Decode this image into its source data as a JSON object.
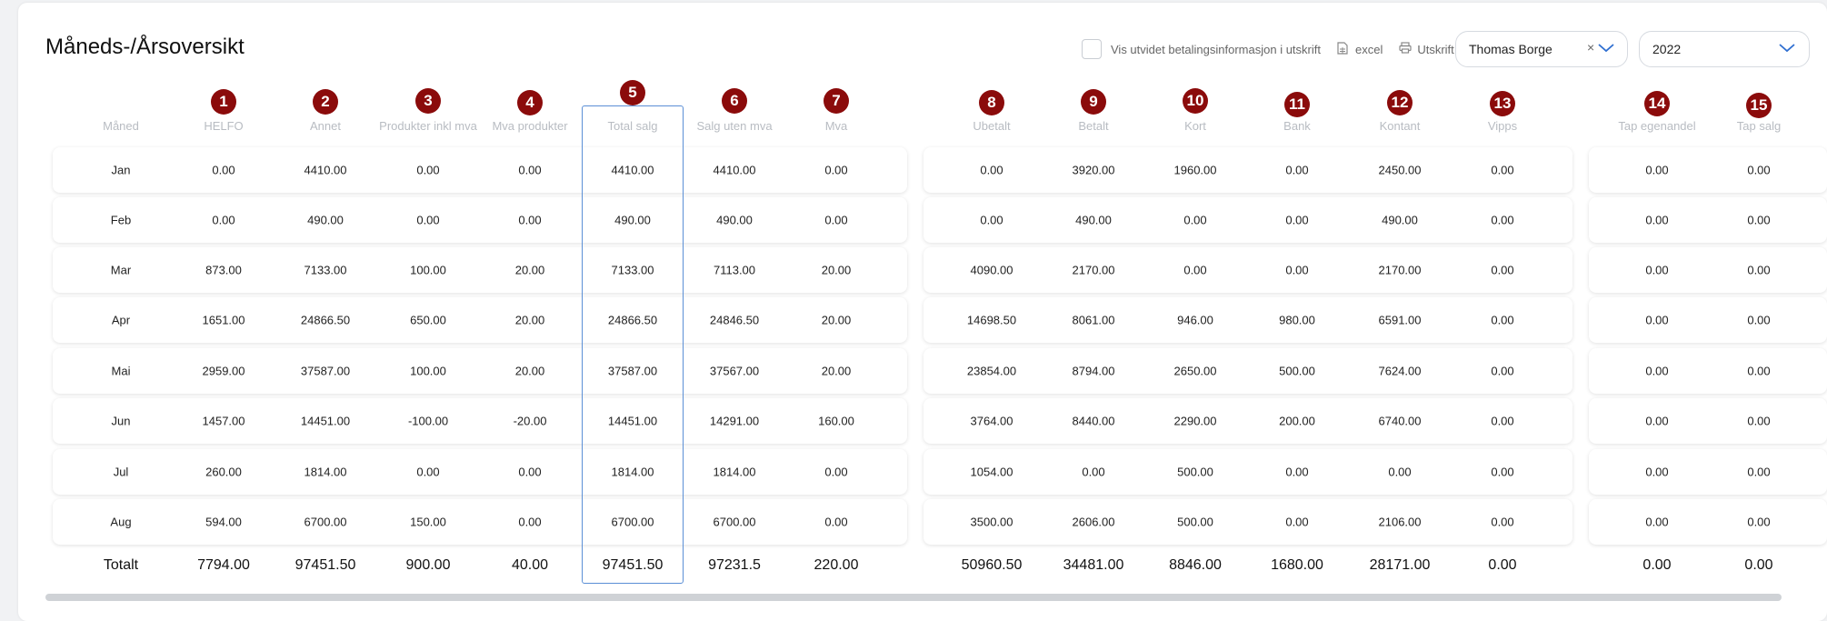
{
  "page": {
    "title": "Måneds-/Årsoversikt",
    "checkbox_label": "Vis utvidet betalingsinformasjon i utskrift",
    "excel_label": "excel",
    "print_label": "Utskrift",
    "person_select": "Thomas Borge",
    "year_select": "2022"
  },
  "icons": {
    "excel": "file-spreadsheet-icon",
    "print": "printer-icon",
    "clear": "close-icon",
    "dropdown": "chevron-down-icon"
  },
  "colors": {
    "badge": "#8b0b0b",
    "highlight_border": "#5b8fd6",
    "header_text": "#b8bcc2"
  },
  "table": {
    "month_header": "Måned",
    "total_label": "Totalt",
    "columns": [
      {
        "num": "1",
        "label": "HELFO"
      },
      {
        "num": "2",
        "label": "Annet"
      },
      {
        "num": "3",
        "label": "Produkter inkl mva"
      },
      {
        "num": "4",
        "label": "Mva produkter"
      },
      {
        "num": "5",
        "label": "Total salg"
      },
      {
        "num": "6",
        "label": "Salg uten mva"
      },
      {
        "num": "7",
        "label": "Mva"
      },
      {
        "num": "8",
        "label": "Ubetalt"
      },
      {
        "num": "9",
        "label": "Betalt"
      },
      {
        "num": "10",
        "label": "Kort"
      },
      {
        "num": "11",
        "label": "Bank"
      },
      {
        "num": "12",
        "label": "Kontant"
      },
      {
        "num": "13",
        "label": "Vipps"
      },
      {
        "num": "14",
        "label": "Tap egenandel"
      },
      {
        "num": "15",
        "label": "Tap salg"
      }
    ],
    "rows": [
      {
        "month": "Jan",
        "values": [
          "0.00",
          "4410.00",
          "0.00",
          "0.00",
          "4410.00",
          "4410.00",
          "0.00",
          "0.00",
          "3920.00",
          "1960.00",
          "0.00",
          "2450.00",
          "0.00",
          "0.00",
          "0.00"
        ]
      },
      {
        "month": "Feb",
        "values": [
          "0.00",
          "490.00",
          "0.00",
          "0.00",
          "490.00",
          "490.00",
          "0.00",
          "0.00",
          "490.00",
          "0.00",
          "0.00",
          "490.00",
          "0.00",
          "0.00",
          "0.00"
        ]
      },
      {
        "month": "Mar",
        "values": [
          "873.00",
          "7133.00",
          "100.00",
          "20.00",
          "7133.00",
          "7113.00",
          "20.00",
          "4090.00",
          "2170.00",
          "0.00",
          "0.00",
          "2170.00",
          "0.00",
          "0.00",
          "0.00"
        ]
      },
      {
        "month": "Apr",
        "values": [
          "1651.00",
          "24866.50",
          "650.00",
          "20.00",
          "24866.50",
          "24846.50",
          "20.00",
          "14698.50",
          "8061.00",
          "946.00",
          "980.00",
          "6591.00",
          "0.00",
          "0.00",
          "0.00"
        ]
      },
      {
        "month": "Mai",
        "values": [
          "2959.00",
          "37587.00",
          "100.00",
          "20.00",
          "37587.00",
          "37567.00",
          "20.00",
          "23854.00",
          "8794.00",
          "2650.00",
          "500.00",
          "7624.00",
          "0.00",
          "0.00",
          "0.00"
        ]
      },
      {
        "month": "Jun",
        "values": [
          "1457.00",
          "14451.00",
          "-100.00",
          "-20.00",
          "14451.00",
          "14291.00",
          "160.00",
          "3764.00",
          "8440.00",
          "2290.00",
          "200.00",
          "6740.00",
          "0.00",
          "0.00",
          "0.00"
        ]
      },
      {
        "month": "Jul",
        "values": [
          "260.00",
          "1814.00",
          "0.00",
          "0.00",
          "1814.00",
          "1814.00",
          "0.00",
          "1054.00",
          "0.00",
          "500.00",
          "0.00",
          "0.00",
          "0.00",
          "0.00",
          "0.00"
        ]
      },
      {
        "month": "Aug",
        "values": [
          "594.00",
          "6700.00",
          "150.00",
          "0.00",
          "6700.00",
          "6700.00",
          "0.00",
          "3500.00",
          "2606.00",
          "500.00",
          "0.00",
          "2106.00",
          "0.00",
          "0.00",
          "0.00"
        ]
      }
    ],
    "totals": [
      "7794.00",
      "97451.50",
      "900.00",
      "40.00",
      "97451.50",
      "97231.5",
      "220.00",
      "50960.50",
      "34481.00",
      "8846.00",
      "1680.00",
      "28171.00",
      "0.00",
      "0.00",
      "0.00"
    ]
  }
}
